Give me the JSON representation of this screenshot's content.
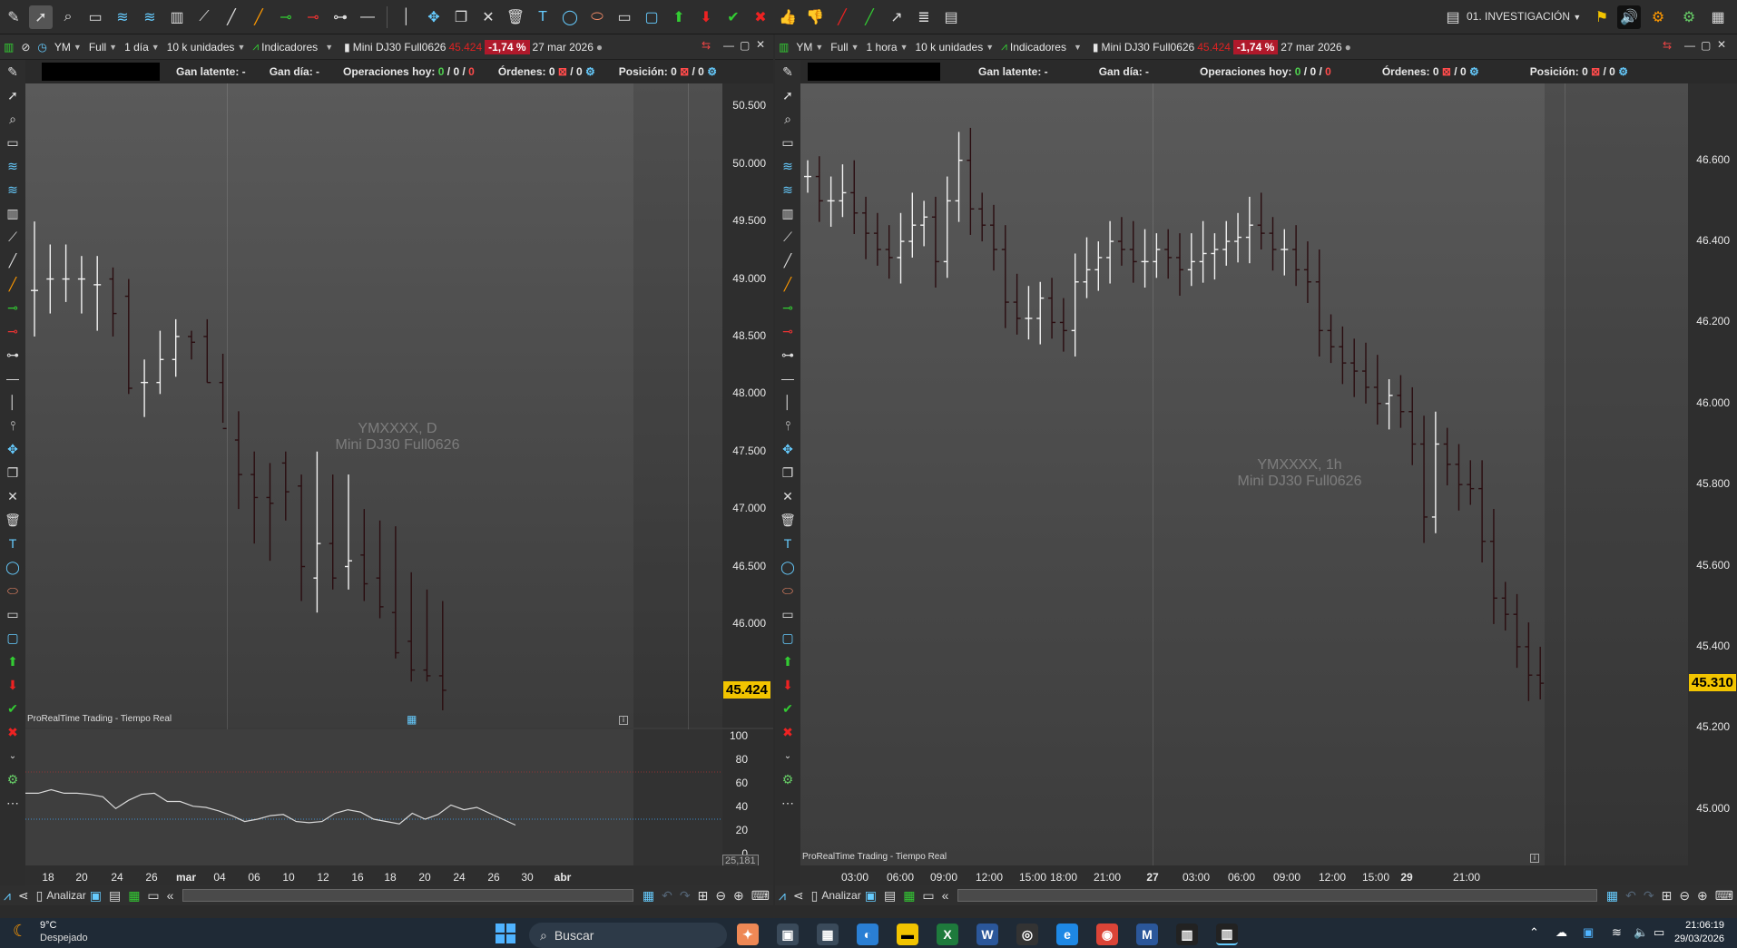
{
  "topbar": {
    "workspace": "01. INVESTIGACIÓN"
  },
  "left_panel": {
    "symbol": "YM",
    "mode": "Full",
    "timeframe": "1 día",
    "units": "10 k unidades",
    "indicators": "Indicadores",
    "instrument": "Mini DJ30 Full0626",
    "price_small": "45.424",
    "change": "-1,74 %",
    "date": "27 mar 2026",
    "info": {
      "gan_latente": "Gan latente: -",
      "gan_dia": "Gan día: -",
      "ops_label": "Operaciones hoy:",
      "ops_v1": "0",
      "ops_v2": "0",
      "ops_v3": "0",
      "ordenes_label": "Órdenes: 0",
      "ordenes_v2": "/ 0",
      "posicion_label": "Posición: 0",
      "posicion_v2": "/ 0"
    },
    "watermark_line1": "YMXXXX, D",
    "watermark_line2": "Mini DJ30 Full0626",
    "source_note": "ProRealTime Trading - Tiempo Real",
    "last_price": "45.424",
    "indicator_value": "25,181",
    "bottom_analyze": "Analizar"
  },
  "right_panel": {
    "symbol": "YM",
    "mode": "Full",
    "timeframe": "1 hora",
    "units": "10 k unidades",
    "indicators": "Indicadores",
    "instrument": "Mini DJ30 Full0626",
    "price_small": "45.424",
    "change": "-1,74 %",
    "date": "27 mar 2026",
    "info": {
      "gan_latente": "Gan latente: -",
      "gan_dia": "Gan día: -",
      "ops_label": "Operaciones hoy:",
      "ops_v1": "0",
      "ops_v2": "0",
      "ops_v3": "0",
      "ordenes_label": "Órdenes: 0",
      "ordenes_v2": "/ 0",
      "posicion_label": "Posición: 0",
      "posicion_v2": "/ 0"
    },
    "watermark_line1": "YMXXXX, 1h",
    "watermark_line2": "Mini DJ30 Full0626",
    "source_note": "ProRealTime Trading - Tiempo Real",
    "last_price": "45.310",
    "bottom_analyze": "Analizar"
  },
  "chart_data": [
    {
      "type": "ohlc",
      "timeframe": "daily",
      "x_labels": [
        "18",
        "20",
        "24",
        "26",
        "mar",
        "04",
        "06",
        "10",
        "12",
        "16",
        "18",
        "20",
        "24",
        "26",
        "30",
        "abr"
      ],
      "y_ticks": [
        "50.500",
        "50.000",
        "49.500",
        "49.000",
        "48.500",
        "48.000",
        "47.500",
        "47.000",
        "46.500",
        "46.000"
      ],
      "ylim": [
        45100,
        50700
      ],
      "bars": [
        {
          "o": 48900,
          "h": 49500,
          "l": 48500,
          "c": 48900
        },
        {
          "o": 49000,
          "h": 49300,
          "l": 48700,
          "c": 49000
        },
        {
          "o": 49000,
          "h": 49300,
          "l": 48800,
          "c": 49000
        },
        {
          "o": 49000,
          "h": 49200,
          "l": 48700,
          "c": 49000
        },
        {
          "o": 48950,
          "h": 49200,
          "l": 48550,
          "c": 48950
        },
        {
          "o": 49000,
          "h": 49100,
          "l": 48500,
          "c": 48700
        },
        {
          "o": 48850,
          "h": 49000,
          "l": 48000,
          "c": 48050
        },
        {
          "o": 48100,
          "h": 48300,
          "l": 47800,
          "c": 48100
        },
        {
          "o": 48100,
          "h": 48550,
          "l": 48000,
          "c": 48300
        },
        {
          "o": 48300,
          "h": 48650,
          "l": 48150,
          "c": 48500
        },
        {
          "o": 48500,
          "h": 48550,
          "l": 48300,
          "c": 48450
        },
        {
          "o": 48500,
          "h": 48650,
          "l": 48100,
          "c": 48100
        },
        {
          "o": 48100,
          "h": 48350,
          "l": 47750,
          "c": 47700
        },
        {
          "o": 47600,
          "h": 47850,
          "l": 47000,
          "c": 47300
        },
        {
          "o": 47300,
          "h": 47500,
          "l": 46700,
          "c": 47100
        },
        {
          "o": 47100,
          "h": 47400,
          "l": 46550,
          "c": 47050
        },
        {
          "o": 47400,
          "h": 47500,
          "l": 46900,
          "c": 47150
        },
        {
          "o": 47200,
          "h": 47300,
          "l": 46200,
          "c": 46500
        },
        {
          "o": 46400,
          "h": 47500,
          "l": 46100,
          "c": 46700
        },
        {
          "o": 46700,
          "h": 47300,
          "l": 46300,
          "c": 46400
        },
        {
          "o": 46500,
          "h": 47300,
          "l": 46300,
          "c": 46550
        },
        {
          "o": 46600,
          "h": 47000,
          "l": 46200,
          "c": 46350
        },
        {
          "o": 46400,
          "h": 46900,
          "l": 46050,
          "c": 46150
        },
        {
          "o": 46100,
          "h": 46850,
          "l": 45700,
          "c": 45750
        },
        {
          "o": 45850,
          "h": 46450,
          "l": 45500,
          "c": 45600
        },
        {
          "o": 45600,
          "h": 46300,
          "l": 45500,
          "c": 45550
        },
        {
          "o": 45550,
          "h": 46200,
          "l": 45250,
          "c": 45424
        }
      ],
      "indicator": {
        "y_ticks": [
          "100",
          "80",
          "60",
          "40",
          "20",
          "0"
        ],
        "ylim": [
          0,
          100
        ],
        "values": [
          52,
          52,
          55,
          52,
          52,
          51,
          49,
          39,
          46,
          51,
          52,
          45,
          45,
          41,
          40,
          37,
          33,
          28,
          30,
          33,
          34,
          28,
          27,
          28,
          35,
          38,
          36,
          30,
          28,
          26,
          35,
          30,
          34,
          42,
          38,
          40,
          35,
          30,
          25
        ]
      }
    },
    {
      "type": "ohlc",
      "timeframe": "1h",
      "x_labels": [
        "03:00",
        "06:00",
        "09:00",
        "12:00",
        "15:00",
        "18:00",
        "21:00",
        "27",
        "03:00",
        "06:00",
        "09:00",
        "12:00",
        "15:00",
        "29",
        "21:00"
      ],
      "y_ticks": [
        "46.600",
        "46.400",
        "46.200",
        "46.000",
        "45.800",
        "45.600",
        "45.400",
        "45.200",
        "45.000"
      ],
      "ylim": [
        44950,
        46700
      ]
    }
  ]
}
